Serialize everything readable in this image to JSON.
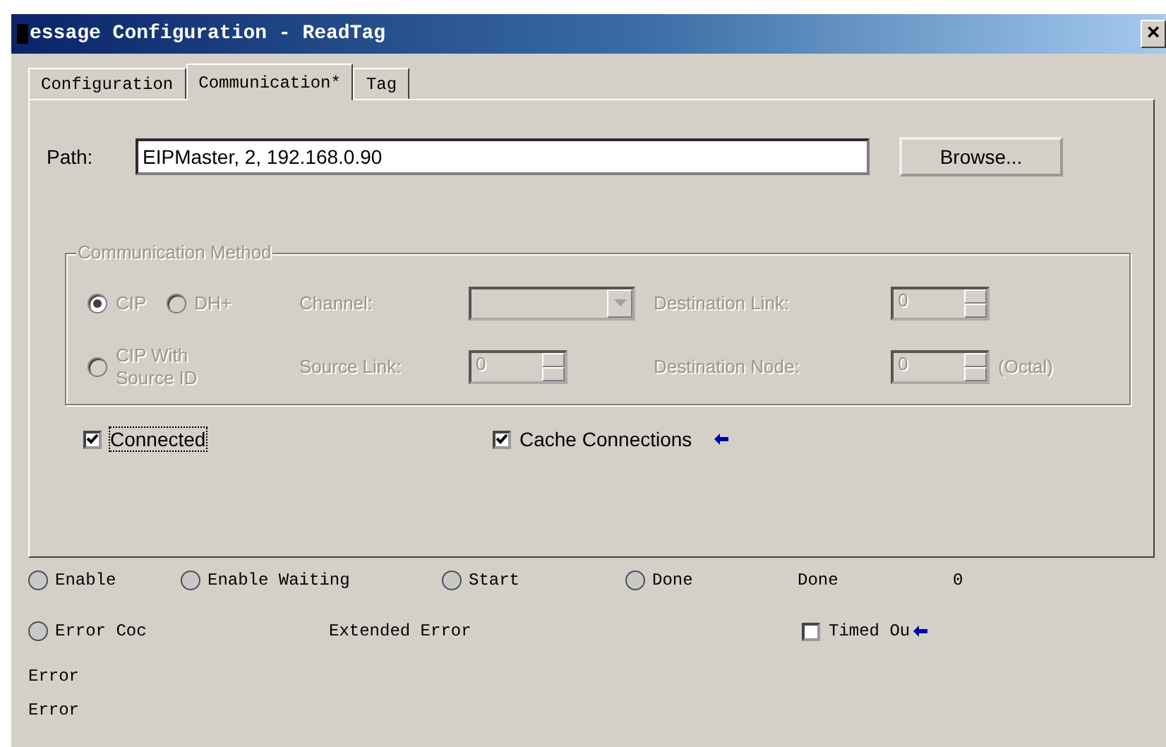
{
  "window": {
    "title": "essage Configuration - ReadTag",
    "close": "×"
  },
  "tabs": [
    {
      "label": "Configuration",
      "selected": false
    },
    {
      "label": "Communication*",
      "selected": true
    },
    {
      "label": "Tag",
      "selected": false
    }
  ],
  "path": {
    "label": "Path:",
    "value": "EIPMaster, 2, 192.168.0.90"
  },
  "browse": "Browse...",
  "method": {
    "title": "Communication Method",
    "disabled": true,
    "radios": [
      {
        "label": "CIP",
        "selected": true
      },
      {
        "label": "DH+",
        "selected": false
      },
      {
        "label": "CIP With Source ID",
        "selected": false
      }
    ],
    "channel_label": "Channel:",
    "source_link": {
      "label": "Source Link:",
      "value": "0"
    },
    "destination_link": {
      "label": "Destination Link:",
      "value": "0"
    },
    "destination_node": {
      "label": "Destination Node:",
      "value": "0",
      "unit": "(Octal)"
    }
  },
  "options": [
    {
      "label": "Connected",
      "checked": true,
      "focused": true
    },
    {
      "label": "Cache Connections",
      "checked": true,
      "focused": false
    }
  ],
  "status": {
    "row_1": [
      {
        "label": "Enable",
        "on": false
      },
      {
        "label": "Enable Waiting",
        "on": false
      },
      {
        "label": "Start",
        "on": false
      },
      {
        "label": "Done",
        "on": false
      }
    ],
    "done_label": "Done",
    "done_value": "0",
    "error_code": {
      "label": "Error Coc",
      "on": false
    },
    "extended_error": "Extended Error",
    "timed_out": {
      "label": "Timed Ou",
      "checked": false
    },
    "error_lines": [
      "Error",
      "Error"
    ]
  }
}
